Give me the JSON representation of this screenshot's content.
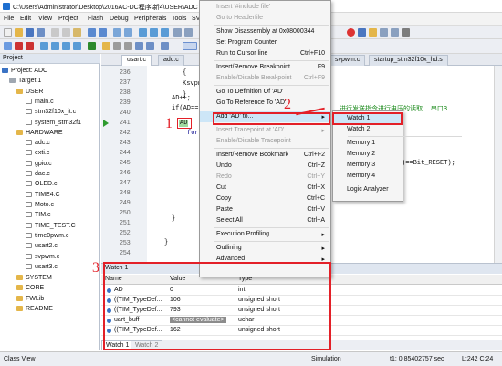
{
  "window": {
    "title": "C:\\Users\\Administrator\\Desktop\\2016AC-DC程序\\新4\\USER\\ADC"
  },
  "menubar": [
    "File",
    "Edit",
    "View",
    "Project",
    "Flash",
    "Debug",
    "Peripherals",
    "Tools",
    "SV"
  ],
  "project": {
    "header": "Project",
    "tree": [
      {
        "label": "Project: ADC",
        "kind": "project"
      },
      {
        "label": "Target 1",
        "kind": "target"
      },
      {
        "label": "USER",
        "kind": "folder"
      },
      {
        "label": "main.c",
        "kind": "file"
      },
      {
        "label": "stm32f10x_it.c",
        "kind": "file"
      },
      {
        "label": "system_stm32f1",
        "kind": "file"
      },
      {
        "label": "HARDWARE",
        "kind": "folder"
      },
      {
        "label": "adc.c",
        "kind": "file"
      },
      {
        "label": "exti.c",
        "kind": "file"
      },
      {
        "label": "gpio.c",
        "kind": "file"
      },
      {
        "label": "dac.c",
        "kind": "file"
      },
      {
        "label": "OLED.c",
        "kind": "file"
      },
      {
        "label": "TIME4.C",
        "kind": "file"
      },
      {
        "label": "Moto.c",
        "kind": "file"
      },
      {
        "label": "TIM.c",
        "kind": "file"
      },
      {
        "label": "TIME_TEST.C",
        "kind": "file"
      },
      {
        "label": "time0pwm.c",
        "kind": "file"
      },
      {
        "label": "usart2.c",
        "kind": "file"
      },
      {
        "label": "svpwm.c",
        "kind": "file"
      },
      {
        "label": "usart3.c",
        "kind": "file"
      },
      {
        "label": "SYSTEM",
        "kind": "folder"
      },
      {
        "label": "CORE",
        "kind": "folder"
      },
      {
        "label": "FWLib",
        "kind": "folder"
      },
      {
        "label": "README",
        "kind": "folder"
      }
    ]
  },
  "tabs": [
    "usart.c",
    "adc.c",
    "svpwm.c",
    "startup_stm32f10x_hd.s"
  ],
  "code": {
    "lines": [
      "236",
      "237",
      "238",
      "239",
      "240",
      "241",
      "242",
      "243",
      "244",
      "245",
      "246",
      "247",
      "248",
      "249",
      "250",
      "251",
      "252",
      "253",
      "254"
    ],
    "l1": "{",
    "l2": "Ksvpw",
    "l3": "}",
    "l4": "AD++;",
    "l5": "if(AD==",
    "l6": "AD",
    "l7": "for",
    "comment": "进行发送指令进行电压的读取.   串口3",
    "cond": ")==Bit_RESET);",
    "l8": "}",
    "l9": "}"
  },
  "context_menu": {
    "items": [
      {
        "label": "Insert '#include file'",
        "shortcut": "",
        "disabled": true
      },
      {
        "label": "Go to Headerfile",
        "shortcut": "",
        "disabled": true
      },
      {
        "sep": true
      },
      {
        "label": "Show Disassembly at 0x08000344",
        "shortcut": ""
      },
      {
        "label": "Set Program Counter",
        "shortcut": ""
      },
      {
        "label": "Run to Cursor line",
        "shortcut": "Ctrl+F10"
      },
      {
        "sep": true
      },
      {
        "label": "Insert/Remove Breakpoint",
        "shortcut": "F9"
      },
      {
        "label": "Enable/Disable Breakpoint",
        "shortcut": "Ctrl+F9",
        "disabled": true
      },
      {
        "sep": true
      },
      {
        "label": "Go To Definition Of 'AD'",
        "shortcut": ""
      },
      {
        "label": "Go To Reference To 'AD'",
        "shortcut": ""
      },
      {
        "sep": true
      },
      {
        "label": "Add 'AD' to...",
        "shortcut": "▸",
        "highlight": true
      },
      {
        "sep": true
      },
      {
        "label": "Insert Tracepoint at 'AD'...",
        "shortcut": "▸",
        "disabled": true
      },
      {
        "label": "Enable/Disable Tracepoint",
        "shortcut": "",
        "disabled": true
      },
      {
        "sep": true
      },
      {
        "label": "Insert/Remove Bookmark",
        "shortcut": "Ctrl+F2"
      },
      {
        "label": "Undo",
        "shortcut": "Ctrl+Z"
      },
      {
        "label": "Redo",
        "shortcut": "Ctrl+Y",
        "disabled": true
      },
      {
        "label": "Cut",
        "shortcut": "Ctrl+X"
      },
      {
        "label": "Copy",
        "shortcut": "Ctrl+C"
      },
      {
        "label": "Paste",
        "shortcut": "Ctrl+V"
      },
      {
        "label": "Select All",
        "shortcut": "Ctrl+A"
      },
      {
        "sep": true
      },
      {
        "label": "Execution Profiling",
        "shortcut": "▸"
      },
      {
        "sep": true
      },
      {
        "label": "Outlining",
        "shortcut": "▸"
      },
      {
        "label": "Advanced",
        "shortcut": "▸"
      }
    ]
  },
  "submenu": {
    "items": [
      {
        "label": "Watch 1",
        "highlight": true
      },
      {
        "label": "Watch 2"
      },
      {
        "sep": true
      },
      {
        "label": "Memory 1"
      },
      {
        "label": "Memory 2"
      },
      {
        "label": "Memory 3"
      },
      {
        "label": "Memory 4"
      },
      {
        "sep": true
      },
      {
        "label": "Logic Analyzer"
      }
    ]
  },
  "watch": {
    "title": "Watch 1",
    "columns": [
      "Name",
      "Value",
      "Type"
    ],
    "rows": [
      {
        "name": "AD",
        "value": "0",
        "type": "int"
      },
      {
        "name": "((TIM_TypeDef...",
        "value": "106",
        "type": "unsigned short"
      },
      {
        "name": "((TIM_TypeDef...",
        "value": "793",
        "type": "unsigned short"
      },
      {
        "name": "uart_buff",
        "value": "<cannot evaluate>",
        "type": "uchar"
      },
      {
        "name": "((TIM_TypeDef...",
        "value": "162",
        "type": "unsigned short"
      }
    ],
    "tabs": [
      "Watch 1",
      "Watch 2"
    ]
  },
  "status": {
    "left": "Class View",
    "mode": "Simulation",
    "time": "t1: 0.85402757 sec",
    "pos": "L:242 C:24"
  },
  "annotations": {
    "one": "1",
    "two": "2",
    "three": "3"
  },
  "colors": {
    "annotation": "#e32028",
    "highlight": "#cde6f7"
  }
}
